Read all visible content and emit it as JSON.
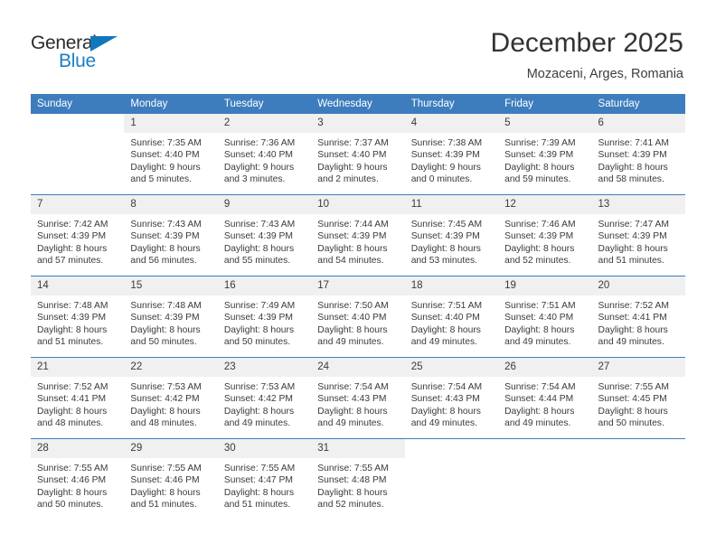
{
  "brand": {
    "name_top": "General",
    "name_bottom": "Blue",
    "accent_color": "#1b7fc4"
  },
  "header": {
    "title": "December 2025",
    "subtitle": "Mozaceni, Arges, Romania"
  },
  "theme": {
    "header_blue": "#3d7dbe",
    "daynum_band": "#f0f0f0",
    "text": "#3a3a3a"
  },
  "calendar": {
    "weekday_headers": [
      "Sunday",
      "Monday",
      "Tuesday",
      "Wednesday",
      "Thursday",
      "Friday",
      "Saturday"
    ],
    "weeks": [
      [
        {
          "day": "",
          "lines": []
        },
        {
          "day": "1",
          "lines": [
            "Sunrise: 7:35 AM",
            "Sunset: 4:40 PM",
            "Daylight: 9 hours",
            "and 5 minutes."
          ]
        },
        {
          "day": "2",
          "lines": [
            "Sunrise: 7:36 AM",
            "Sunset: 4:40 PM",
            "Daylight: 9 hours",
            "and 3 minutes."
          ]
        },
        {
          "day": "3",
          "lines": [
            "Sunrise: 7:37 AM",
            "Sunset: 4:40 PM",
            "Daylight: 9 hours",
            "and 2 minutes."
          ]
        },
        {
          "day": "4",
          "lines": [
            "Sunrise: 7:38 AM",
            "Sunset: 4:39 PM",
            "Daylight: 9 hours",
            "and 0 minutes."
          ]
        },
        {
          "day": "5",
          "lines": [
            "Sunrise: 7:39 AM",
            "Sunset: 4:39 PM",
            "Daylight: 8 hours",
            "and 59 minutes."
          ]
        },
        {
          "day": "6",
          "lines": [
            "Sunrise: 7:41 AM",
            "Sunset: 4:39 PM",
            "Daylight: 8 hours",
            "and 58 minutes."
          ]
        }
      ],
      [
        {
          "day": "7",
          "lines": [
            "Sunrise: 7:42 AM",
            "Sunset: 4:39 PM",
            "Daylight: 8 hours",
            "and 57 minutes."
          ]
        },
        {
          "day": "8",
          "lines": [
            "Sunrise: 7:43 AM",
            "Sunset: 4:39 PM",
            "Daylight: 8 hours",
            "and 56 minutes."
          ]
        },
        {
          "day": "9",
          "lines": [
            "Sunrise: 7:43 AM",
            "Sunset: 4:39 PM",
            "Daylight: 8 hours",
            "and 55 minutes."
          ]
        },
        {
          "day": "10",
          "lines": [
            "Sunrise: 7:44 AM",
            "Sunset: 4:39 PM",
            "Daylight: 8 hours",
            "and 54 minutes."
          ]
        },
        {
          "day": "11",
          "lines": [
            "Sunrise: 7:45 AM",
            "Sunset: 4:39 PM",
            "Daylight: 8 hours",
            "and 53 minutes."
          ]
        },
        {
          "day": "12",
          "lines": [
            "Sunrise: 7:46 AM",
            "Sunset: 4:39 PM",
            "Daylight: 8 hours",
            "and 52 minutes."
          ]
        },
        {
          "day": "13",
          "lines": [
            "Sunrise: 7:47 AM",
            "Sunset: 4:39 PM",
            "Daylight: 8 hours",
            "and 51 minutes."
          ]
        }
      ],
      [
        {
          "day": "14",
          "lines": [
            "Sunrise: 7:48 AM",
            "Sunset: 4:39 PM",
            "Daylight: 8 hours",
            "and 51 minutes."
          ]
        },
        {
          "day": "15",
          "lines": [
            "Sunrise: 7:48 AM",
            "Sunset: 4:39 PM",
            "Daylight: 8 hours",
            "and 50 minutes."
          ]
        },
        {
          "day": "16",
          "lines": [
            "Sunrise: 7:49 AM",
            "Sunset: 4:39 PM",
            "Daylight: 8 hours",
            "and 50 minutes."
          ]
        },
        {
          "day": "17",
          "lines": [
            "Sunrise: 7:50 AM",
            "Sunset: 4:40 PM",
            "Daylight: 8 hours",
            "and 49 minutes."
          ]
        },
        {
          "day": "18",
          "lines": [
            "Sunrise: 7:51 AM",
            "Sunset: 4:40 PM",
            "Daylight: 8 hours",
            "and 49 minutes."
          ]
        },
        {
          "day": "19",
          "lines": [
            "Sunrise: 7:51 AM",
            "Sunset: 4:40 PM",
            "Daylight: 8 hours",
            "and 49 minutes."
          ]
        },
        {
          "day": "20",
          "lines": [
            "Sunrise: 7:52 AM",
            "Sunset: 4:41 PM",
            "Daylight: 8 hours",
            "and 49 minutes."
          ]
        }
      ],
      [
        {
          "day": "21",
          "lines": [
            "Sunrise: 7:52 AM",
            "Sunset: 4:41 PM",
            "Daylight: 8 hours",
            "and 48 minutes."
          ]
        },
        {
          "day": "22",
          "lines": [
            "Sunrise: 7:53 AM",
            "Sunset: 4:42 PM",
            "Daylight: 8 hours",
            "and 48 minutes."
          ]
        },
        {
          "day": "23",
          "lines": [
            "Sunrise: 7:53 AM",
            "Sunset: 4:42 PM",
            "Daylight: 8 hours",
            "and 49 minutes."
          ]
        },
        {
          "day": "24",
          "lines": [
            "Sunrise: 7:54 AM",
            "Sunset: 4:43 PM",
            "Daylight: 8 hours",
            "and 49 minutes."
          ]
        },
        {
          "day": "25",
          "lines": [
            "Sunrise: 7:54 AM",
            "Sunset: 4:43 PM",
            "Daylight: 8 hours",
            "and 49 minutes."
          ]
        },
        {
          "day": "26",
          "lines": [
            "Sunrise: 7:54 AM",
            "Sunset: 4:44 PM",
            "Daylight: 8 hours",
            "and 49 minutes."
          ]
        },
        {
          "day": "27",
          "lines": [
            "Sunrise: 7:55 AM",
            "Sunset: 4:45 PM",
            "Daylight: 8 hours",
            "and 50 minutes."
          ]
        }
      ],
      [
        {
          "day": "28",
          "lines": [
            "Sunrise: 7:55 AM",
            "Sunset: 4:46 PM",
            "Daylight: 8 hours",
            "and 50 minutes."
          ]
        },
        {
          "day": "29",
          "lines": [
            "Sunrise: 7:55 AM",
            "Sunset: 4:46 PM",
            "Daylight: 8 hours",
            "and 51 minutes."
          ]
        },
        {
          "day": "30",
          "lines": [
            "Sunrise: 7:55 AM",
            "Sunset: 4:47 PM",
            "Daylight: 8 hours",
            "and 51 minutes."
          ]
        },
        {
          "day": "31",
          "lines": [
            "Sunrise: 7:55 AM",
            "Sunset: 4:48 PM",
            "Daylight: 8 hours",
            "and 52 minutes."
          ]
        },
        {
          "day": "",
          "lines": []
        },
        {
          "day": "",
          "lines": []
        },
        {
          "day": "",
          "lines": []
        }
      ]
    ]
  }
}
